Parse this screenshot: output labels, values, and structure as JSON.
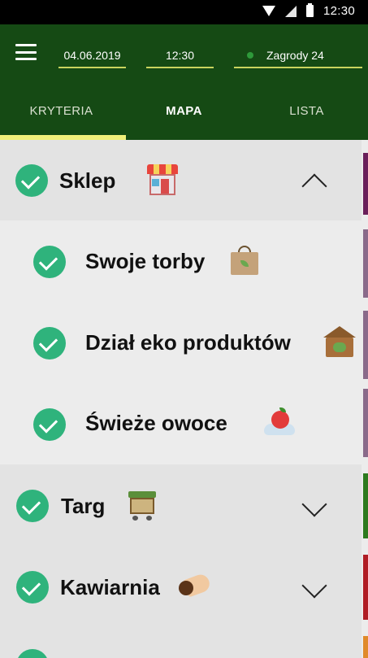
{
  "status_bar": {
    "time": "12:30"
  },
  "toolbar": {
    "date": "04.06.2019",
    "time": "12:30",
    "location": "Zagrody 24"
  },
  "tabs": [
    {
      "label": "KRYTERIA",
      "active": true
    },
    {
      "label": "MAPA"
    },
    {
      "label": "LISTA"
    }
  ],
  "categories": [
    {
      "label": "Sklep",
      "icon": "shop-icon",
      "expanded": true,
      "color": "#6a1f5a",
      "items": [
        {
          "label": "Swoje torby",
          "icon": "bag-icon"
        },
        {
          "label": "Dział eko produktów",
          "icon": "eco-box-icon"
        },
        {
          "label": "Świeże owoce",
          "icon": "apple-in-hand-icon"
        }
      ]
    },
    {
      "label": "Targ",
      "icon": "market-stall-icon",
      "expanded": false,
      "color": "#2d7a1e"
    },
    {
      "label": "Kawiarnia",
      "icon": "coffee-icon",
      "expanded": false,
      "color": "#b01c24"
    }
  ],
  "colors": {
    "header": "#154a14",
    "tab_indicator": "#f0f07a",
    "check": "#2fb37c",
    "sub_item_bar": "#8a6a8a",
    "next_bar": "#e08a2a"
  }
}
